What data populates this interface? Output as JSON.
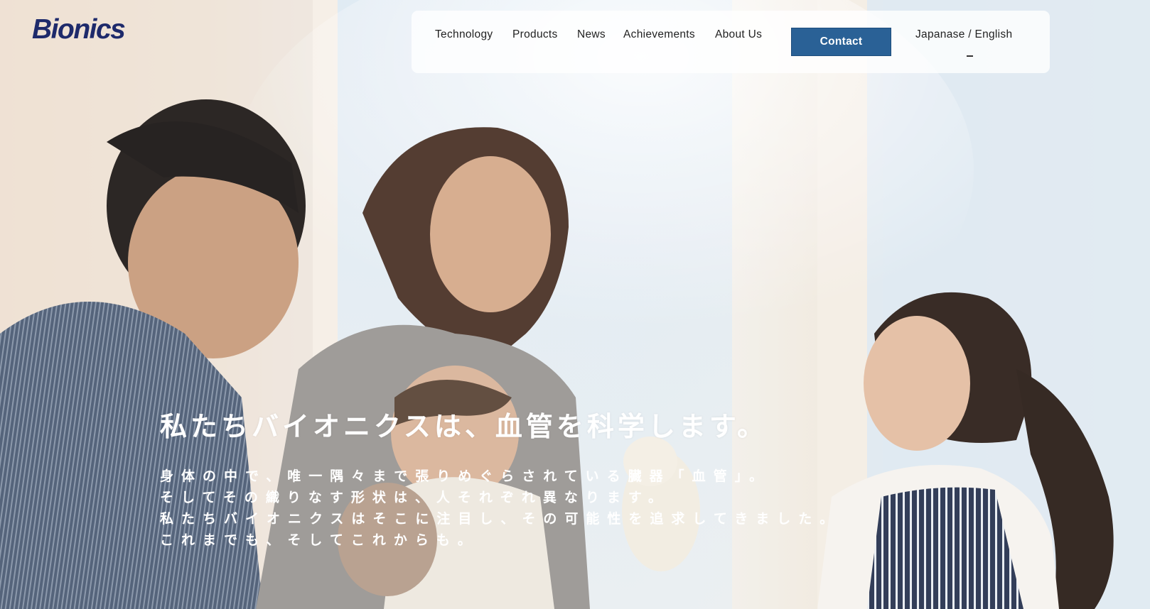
{
  "brand": {
    "logo_text": "Bionics"
  },
  "nav": {
    "items": [
      {
        "label": "Technology"
      },
      {
        "label": "Products"
      },
      {
        "label": "News"
      },
      {
        "label": "Achievements"
      },
      {
        "label": "About Us"
      }
    ],
    "contact_label": "Contact",
    "language_label": "Japanase / English"
  },
  "hero": {
    "headline": "私たちバイオニクスは、血管を科学します。",
    "lines": [
      "身体の中で、唯一隅々まで張りめぐらされている臓器「血管」。",
      "そしてその織りなす形状は、人それぞれ異なります。",
      "私たちバイオニクスはそこに注目し、その可能性を追求してきました。",
      "これまでも、そしてこれからも。"
    ]
  },
  "colors": {
    "brand_navy": "#1e2a6b",
    "contact_button": "#2a6196",
    "hero_text": "#ffffff"
  },
  "icons": {
    "hero_image": "family-photo"
  }
}
